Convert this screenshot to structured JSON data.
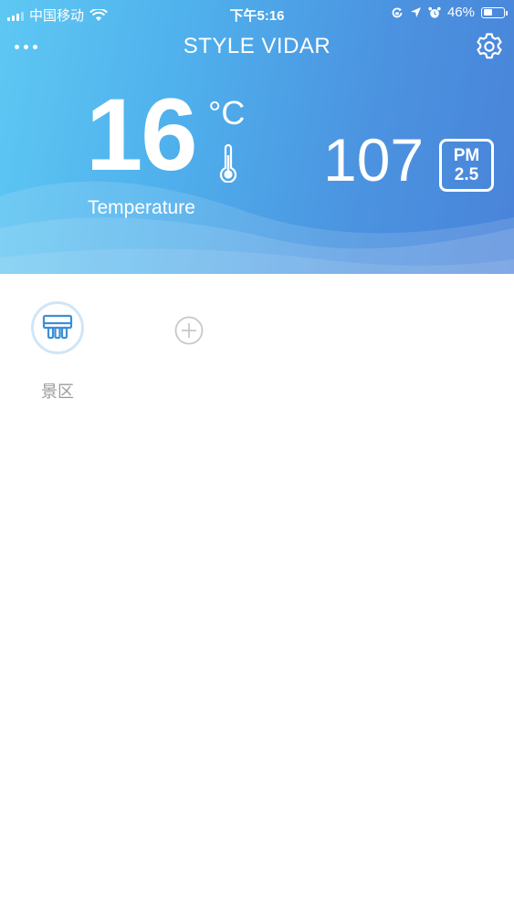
{
  "status_bar": {
    "carrier": "中国移动",
    "time": "下午5:16",
    "battery_percent": "46%",
    "battery_level": 0.46,
    "icons": [
      "signal-icon",
      "wifi-icon",
      "screen-lock-icon",
      "location-arrow-icon",
      "alarm-icon",
      "battery-icon"
    ]
  },
  "header": {
    "title": "STYLE VIDAR",
    "left_icon": "more-dots-icon",
    "right_icon": "gear-icon"
  },
  "weather": {
    "temperature": "16",
    "temperature_unit": "°C",
    "temperature_label": "Temperature",
    "pm_value": "107",
    "pm_badge_top": "PM",
    "pm_badge_bottom": "2.5"
  },
  "devices": [
    {
      "label": "景区",
      "icon": "air-conditioner-icon"
    }
  ],
  "add_device_icon": "plus-circle-icon",
  "colors": {
    "header_gradient_start": "#5ec8f3",
    "header_gradient_end": "#4a83d9",
    "device_ring": "#cfe6f7",
    "device_icon": "#3d8fd6",
    "device_label": "#9a9a9a",
    "add_icon": "#c8c8c8"
  }
}
